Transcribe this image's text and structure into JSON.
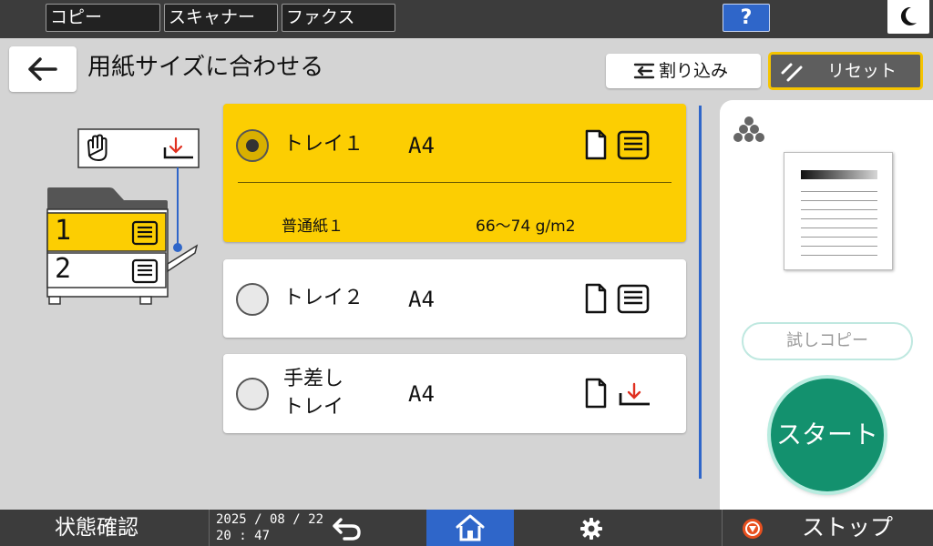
{
  "top_tabs": [
    "コピー",
    "スキャナー",
    "ファクス"
  ],
  "help": {
    "label": "?"
  },
  "header": {
    "title": "用紙サイズに合わせる",
    "interrupt_label": "割り込み",
    "reset_label": "リセット"
  },
  "diagram": {
    "tray1": "1",
    "tray2": "2"
  },
  "trays": [
    {
      "name": "トレイ１",
      "size": "A4",
      "paper_type": "普通紙１",
      "weight": "66～74 g/m2",
      "selected": true
    },
    {
      "name": "トレイ２",
      "size": "A4",
      "selected": false
    },
    {
      "name": "手差し",
      "name2": "トレイ",
      "size": "A4",
      "selected": false
    }
  ],
  "right_panel": {
    "test_copy_label": "試しコピー",
    "start_label": "スタート"
  },
  "footer": {
    "status_label": "状態確認",
    "date": "2025 / 08 / 22",
    "time": "20 : 47",
    "stop_label": "ストップ"
  },
  "colors": {
    "accent_yellow": "#fcce02",
    "start_green": "#13916e",
    "home_blue": "#2f66c9",
    "bar_dark": "#3c3c3c"
  }
}
